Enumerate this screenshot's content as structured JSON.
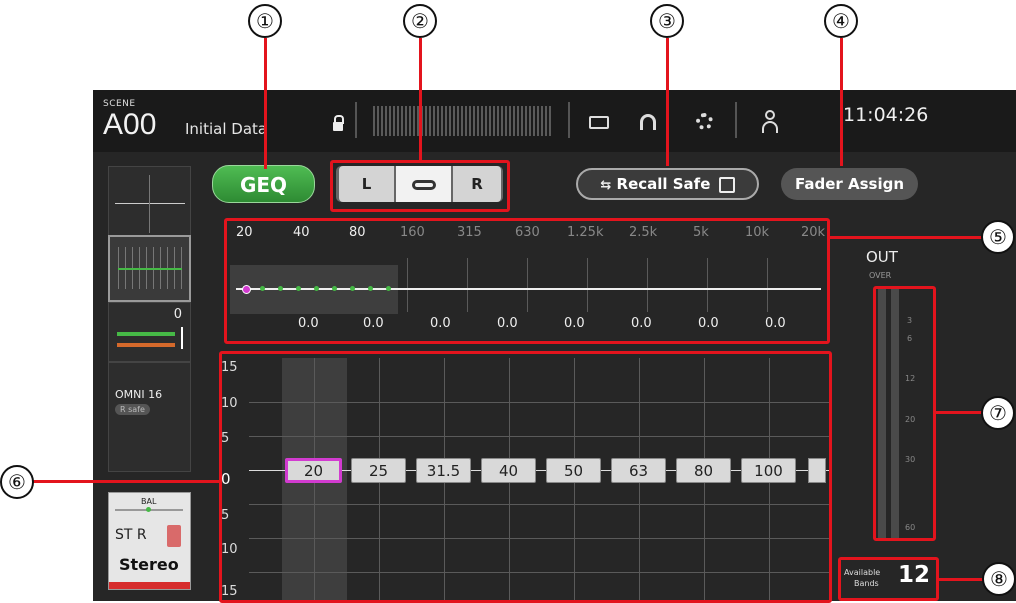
{
  "callouts": [
    "①",
    "②",
    "③",
    "④",
    "⑤",
    "⑥",
    "⑦",
    "⑧"
  ],
  "header": {
    "scene_label": "SCENE",
    "scene_number": "A00",
    "scene_name": "Initial Data",
    "clock": "11:04:26"
  },
  "toolbar": {
    "geq_label": "GEQ",
    "link_left": "L",
    "link_right": "R",
    "recall_safe_label": "Recall Safe",
    "fader_assign_label": "Fader Assign"
  },
  "channel": {
    "level_value": "0",
    "port_name": "OMNI 16",
    "safe_badge": "R safe",
    "bal_label": "BAL",
    "channel_id": "ST R",
    "channel_name": "Stereo"
  },
  "freq_labels": [
    "20",
    "40",
    "80",
    "160",
    "315",
    "630",
    "1.25k",
    "2.5k",
    "5k",
    "10k",
    "20k"
  ],
  "gain_values": [
    "0.0",
    "0.0",
    "0.0",
    "0.0",
    "0.0",
    "0.0",
    "0.0",
    "0.0"
  ],
  "gain_scale": [
    "15",
    "10",
    "5",
    "0",
    "5",
    "10",
    "15"
  ],
  "bands": [
    "20",
    "25",
    "31.5",
    "40",
    "50",
    "63",
    "80",
    "100"
  ],
  "meter": {
    "out_label": "OUT",
    "over_label": "OVER",
    "scale": [
      "3",
      "6",
      "12",
      "20",
      "30",
      "60"
    ]
  },
  "available": {
    "label_line1": "Available",
    "label_line2": "Bands",
    "count": "12"
  },
  "colors": {
    "geq_button": "#3fa043",
    "accent_pink": "#d23bd0",
    "fader_green": "#46b946",
    "callout_red": "#e3141d"
  }
}
